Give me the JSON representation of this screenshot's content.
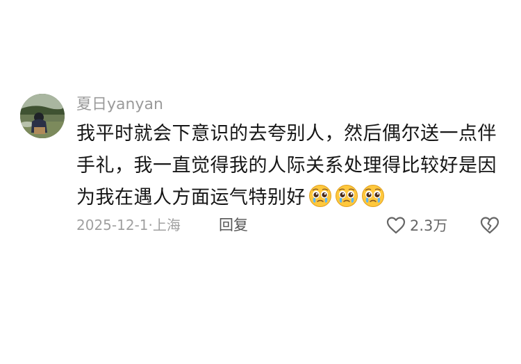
{
  "comment": {
    "author": "夏日yanyan",
    "text_lines": [
      "我平时就会下意识的去夸别人，然后偶尔送一点伴",
      "手礼，我一直觉得我的人际关系处理得比较好是因",
      "为我在遇人方面运气特别好"
    ],
    "emojis": [
      "pleading-face-icon",
      "pleading-face-icon",
      "pleading-face-icon"
    ],
    "date_location": "2025-12-1·上海",
    "reply_label": "回复",
    "like_count": "2.3万",
    "icons": {
      "like": "heart-outline-icon",
      "dislike": "broken-heart-icon"
    }
  },
  "colors": {
    "text": "#161616",
    "meta": "#a0a0a0",
    "username": "#9a9a9a"
  }
}
